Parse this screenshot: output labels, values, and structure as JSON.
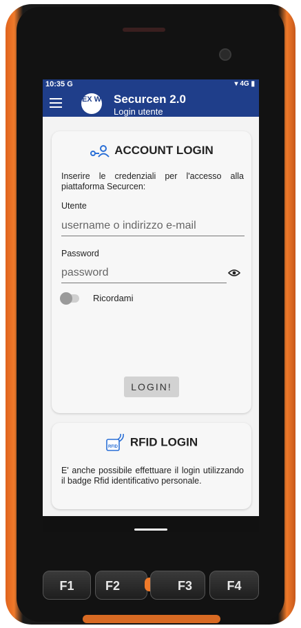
{
  "status_bar": {
    "time": "10:35",
    "left_icons": "G",
    "right_icons": "4G"
  },
  "app_bar": {
    "logo_text": "EX W",
    "title": "Securcen 2.0",
    "subtitle": "Login utente"
  },
  "account_login": {
    "heading": "ACCOUNT LOGIN",
    "intro": "Inserire le credenziali per l'accesso alla piattaforma Securcen:",
    "user_label": "Utente",
    "user_placeholder": "username o indirizzo e-mail",
    "password_label": "Password",
    "password_placeholder": "password",
    "remember_label": "Ricordami",
    "remember_on": false,
    "login_button": "LOGIN!"
  },
  "rfid_login": {
    "heading": "RFID LOGIN",
    "icon_text": "RFID",
    "description": "E' anche possibile effettuare il login utilizzando il badge Rfid identificativo personale."
  },
  "function_keys": [
    "F1",
    "F2",
    "F3",
    "F4"
  ],
  "colors": {
    "app_bar": "#1f3e8a",
    "accent_icon": "#2a6fd6",
    "device_trim": "#f07a2a"
  }
}
